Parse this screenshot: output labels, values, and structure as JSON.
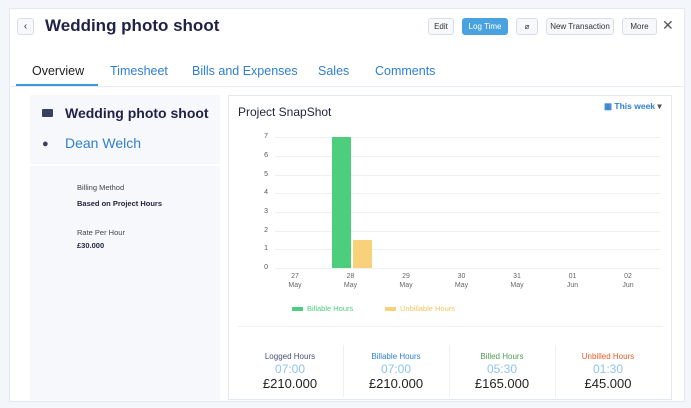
{
  "header": {
    "title": "Wedding photo shoot",
    "edit": "Edit",
    "log_time": "Log Time",
    "new_transaction": "New Transaction",
    "more": "More"
  },
  "tabs": [
    "Overview",
    "Timesheet",
    "Bills and Expenses",
    "Sales",
    "Comments"
  ],
  "left": {
    "project": "Wedding photo shoot",
    "customer": "Dean Welch",
    "billing_method_label": "Billing Method",
    "billing_method": "Based on Project Hours",
    "rate_label": "Rate Per Hour",
    "rate": "£30.000"
  },
  "snapshot": {
    "title": "Project SnapShot",
    "period": "This week"
  },
  "chart_data": {
    "type": "bar",
    "categories": [
      "27 May",
      "28 May",
      "29 May",
      "30 May",
      "31 May",
      "01 Jun",
      "02 Jun"
    ],
    "cat_lines": [
      [
        "27",
        "May"
      ],
      [
        "28",
        "May"
      ],
      [
        "29",
        "May"
      ],
      [
        "30",
        "May"
      ],
      [
        "31",
        "May"
      ],
      [
        "01",
        "Jun"
      ],
      [
        "02",
        "Jun"
      ]
    ],
    "series": [
      {
        "name": "Billable Hours",
        "color": "#4cce7d",
        "values": [
          0,
          7,
          0,
          0,
          0,
          0,
          0
        ]
      },
      {
        "name": "Unbillable Hours",
        "color": "#f8d27a",
        "values": [
          0,
          1.5,
          0,
          0,
          0,
          0,
          0
        ]
      }
    ],
    "ylim": [
      0,
      7
    ],
    "yticks": [
      "0",
      "1",
      "2",
      "3",
      "4",
      "5",
      "6",
      "7"
    ],
    "legend": "bottom"
  },
  "stats": [
    {
      "label": "Logged Hours",
      "color": "#4a4f7a",
      "hours": "07:00",
      "amount": "£210.000"
    },
    {
      "label": "Billable Hours",
      "color": "#2f7fd0",
      "hours": "07:00",
      "amount": "£210.000"
    },
    {
      "label": "Billed Hours",
      "color": "#4f9a55",
      "hours": "05:30",
      "amount": "£165.000"
    },
    {
      "label": "Unbilled Hours",
      "color": "#f05a23",
      "hours": "01:30",
      "amount": "£45.000"
    }
  ]
}
